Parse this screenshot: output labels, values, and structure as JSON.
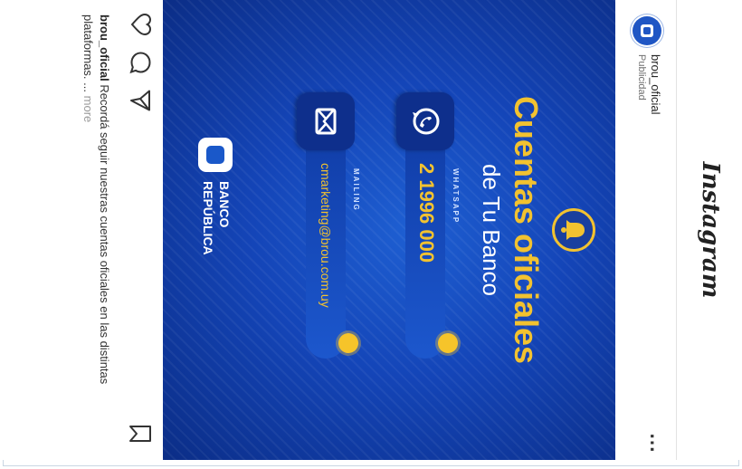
{
  "app": {
    "wordmark": "Instagram"
  },
  "post": {
    "username": "brou_oficial",
    "sponsored_label": "Publicidad",
    "more_icon": "more-options-icon",
    "ad": {
      "headline": "Cuentas oficiales",
      "subheadline": "de Tu Banco",
      "contacts": [
        {
          "label": "WHATSAPP",
          "value": "2 1996 000",
          "icon": "whatsapp-icon"
        },
        {
          "label": "MAILING",
          "value": "cmarketing@brou.com.uy",
          "icon": "mail-icon"
        }
      ],
      "bank_logo_lines": [
        "BANCO",
        "REPÚBLICA"
      ]
    },
    "actions": {
      "like": "heart-icon",
      "comment": "comment-icon",
      "share": "send-icon",
      "save": "bookmark-icon"
    },
    "caption": {
      "username": "brou_oficial",
      "text": "Recordá seguir nuestras cuentas oficiales en las distintas plataformas.",
      "ellipsis": "...",
      "more_label": "more"
    }
  },
  "colors": {
    "brand_blue": "#1445b8",
    "accent_yellow": "#f2c230"
  }
}
